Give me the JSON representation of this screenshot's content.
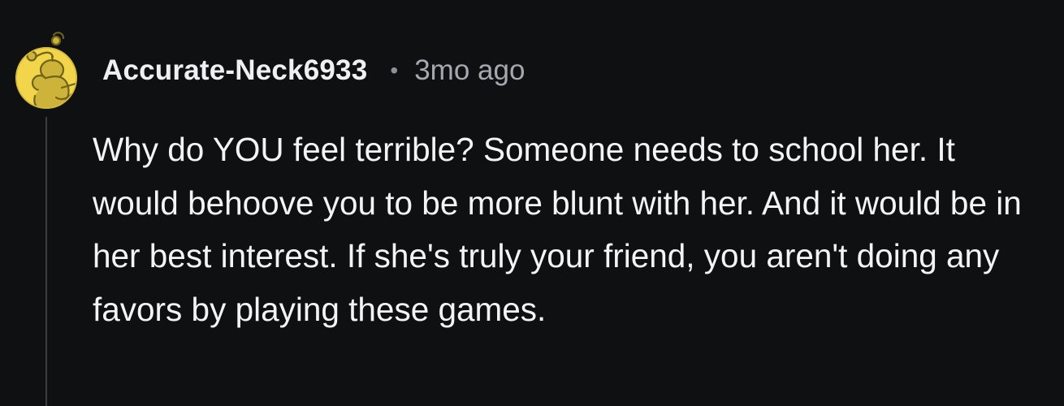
{
  "comment": {
    "author": "Accurate-Neck6933",
    "separator": "•",
    "timestamp": "3mo ago",
    "body": "Why do YOU feel terrible? Someone needs to school her. It would behoove you to be more blunt with her. And it would be in her best interest. If she's truly your friend, you aren't doing any favors by playing these games.",
    "avatar_icon": "snoo-avatar-icon",
    "avatar_color": "#f2d54a"
  }
}
